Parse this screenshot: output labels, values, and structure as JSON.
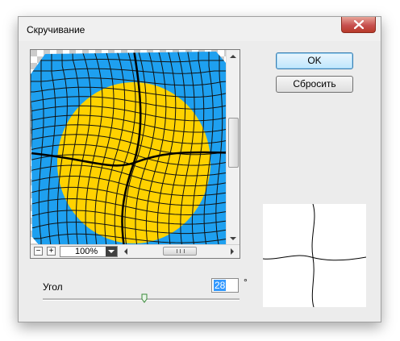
{
  "dialog": {
    "title": "Скручивание",
    "ok_label": "OK",
    "reset_label": "Сбросить"
  },
  "preview": {
    "zoom_out_label": "−",
    "zoom_in_label": "+",
    "zoom_value": "100%"
  },
  "angle": {
    "label": "Угол",
    "value": "28",
    "unit": "°",
    "slider_fraction": 0.55
  },
  "icons": {
    "close": "close-icon",
    "zoom_dropdown": "chevron-down-icon"
  },
  "colors": {
    "sky": "#1ea0f0",
    "sun": "#ffd200",
    "grid": "#111111",
    "close_button": "#c75050",
    "primary_button_border": "#3c7fb1"
  }
}
